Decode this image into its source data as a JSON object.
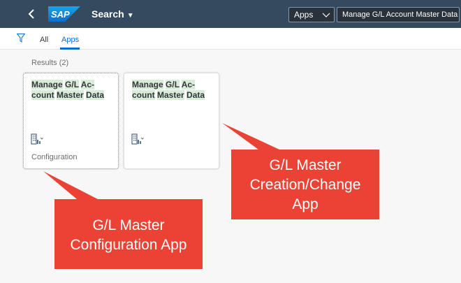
{
  "shell": {
    "logo_text": "SAP",
    "search_title": "Search",
    "scope": "Apps",
    "search_value": "Manage G/L Account Master Data"
  },
  "tabs": [
    {
      "label": "All",
      "active": false
    },
    {
      "label": "Apps",
      "active": true
    }
  ],
  "results_label": "Results (2)",
  "tiles": [
    {
      "title_parts": [
        "Manage",
        "G/L",
        "Ac-",
        "count",
        "Master",
        "Data"
      ],
      "subtitle": "Configuration",
      "icon": "building-chart-icon"
    },
    {
      "title_parts": [
        "Manage",
        "G/L",
        "Ac-",
        "count",
        "Master",
        "Data"
      ],
      "subtitle": "",
      "icon": "building-chart-icon"
    }
  ],
  "callouts": [
    {
      "lines": [
        "G/L Master",
        "Creation/Change",
        "App"
      ]
    },
    {
      "lines": [
        "G/L Master",
        "Configuration App"
      ]
    }
  ],
  "colors": {
    "shell": "#354a5f",
    "accent": "#0a6ed1",
    "callout": "#ea4335",
    "highlight": "#d8ecd8"
  }
}
